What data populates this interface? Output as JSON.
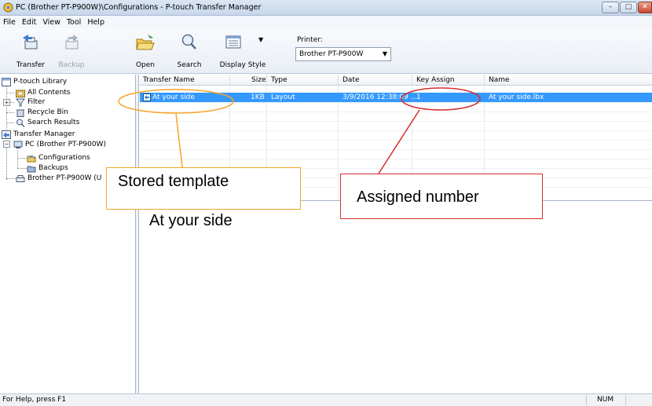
{
  "window": {
    "title": "PC (Brother PT-P900W)\\Configurations - P-touch Transfer Manager",
    "minimize_glyph": "–",
    "maximize_glyph": "□",
    "close_glyph": "✕"
  },
  "menu": [
    "File",
    "Edit",
    "View",
    "Tool",
    "Help"
  ],
  "toolbar": {
    "transfer_label": "Transfer",
    "backup_label": "Backup",
    "open_label": "Open",
    "search_label": "Search",
    "display_style_label": "Display Style",
    "printer_label": "Printer:",
    "printer_value": "Brother PT-P900W"
  },
  "tree": {
    "ptouch_library": "P-touch Library",
    "all_contents": "All Contents",
    "filter": "Filter",
    "recycle_bin": "Recycle Bin",
    "search_results": "Search Results",
    "transfer_manager": "Transfer Manager",
    "pc": "PC (Brother PT-P900W)",
    "configurations": "Configurations",
    "backups": "Backups",
    "device": "Brother PT-P900W (U"
  },
  "list": {
    "columns": {
      "transfer_name": "Transfer Name",
      "size": "Size",
      "type": "Type",
      "date": "Date",
      "key_assign": "Key Assign",
      "name": "Name"
    },
    "rows": [
      {
        "transfer_name": "At your side",
        "size": "1KB",
        "type": "Layout",
        "date": "3/9/2016 12:38:09 ...",
        "key_assign": "1",
        "name": "At your side.lbx"
      }
    ]
  },
  "preview": {
    "text": "At your side"
  },
  "callouts": {
    "stored_template": "Stored template",
    "assigned_number": "Assigned number"
  },
  "colors": {
    "selection": "#3399ff",
    "callout_orange": "#f5a52a",
    "callout_red": "#d32f2f"
  },
  "status": {
    "help": "For Help, press F1",
    "num": "NUM"
  }
}
